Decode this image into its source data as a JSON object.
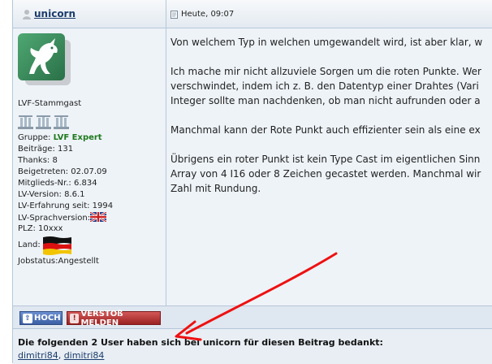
{
  "author": {
    "username": "unicorn",
    "rank_title": "LVF-Stammgast",
    "rank_icon_count": 3,
    "group_label": "Gruppe:",
    "group_value": "LVF Expert",
    "posts": "Beiträge: 131",
    "thanks": "Thanks: 8",
    "joined": "Beigetreten: 02.07.09",
    "member_no": "Mitglieds-Nr.: 6.834",
    "lv_version": "LV-Version: 8.6.1",
    "lv_experience": "LV-Erfahrung seit: 1994",
    "lv_language": "LV-Sprachversion:",
    "zip": "PLZ: 10xxx",
    "country": "Land:",
    "job_status": "Jobstatus:Angestellt",
    "language_flag": "gb-flag-icon",
    "country_flag": "de-flag-icon"
  },
  "post": {
    "date": "Heute, 09:07",
    "paragraphs": [
      [
        "Von welchem Typ in welchen umgewandelt wird, ist aber klar, w"
      ],
      [
        "Ich mache mir nicht allzuviele Sorgen um die roten Punkte. Wer",
        "verschwindet, indem ich z. B. den Datentyp einer Drahtes (Vari",
        "Integer sollte man nachdenken, ob man nicht aufrunden oder a"
      ],
      [
        "Manchmal kann der Rote Punkt auch effizienter sein als eine ex"
      ],
      [
        "Übrigens ein roter Punkt ist kein Type Cast im eigentlichen Sinn",
        "Array von 4 I16 oder 8 Zeichen gecastet werden. Manchmal wir",
        "Zahl mit Rundung."
      ]
    ]
  },
  "buttons": {
    "top_label": "HOCH",
    "report_label": "VERSTOß MELDEN"
  },
  "thanks_box": {
    "text": "Die folgenden 2 User haben sich bei unicorn für diesen Beitrag bedankt:",
    "users": [
      "dimitri84",
      "dimitri84"
    ],
    "separator": ", "
  },
  "colors": {
    "arrow": "#ee1111",
    "group_expert": "#1e7a1e",
    "link": "#1c3c6c",
    "top_button": "#3b5fa3",
    "report_button": "#9b2222"
  }
}
